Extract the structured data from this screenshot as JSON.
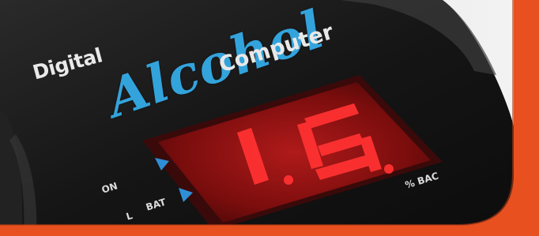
{
  "device": {
    "brand_line_1": "Digital",
    "brand_line_2": "Alcohol",
    "brand_line_3": "Computer",
    "display_reading": "1.6.",
    "indicator_on": "ON",
    "indicator_bat": "BAT",
    "indicator_l": "L",
    "unit_label": "% BAC"
  },
  "colors": {
    "frame_orange": "#e8501f",
    "device_body": "#1a1a1a",
    "display_red": "#ff2a2a",
    "alcohol_blue": "#33a3dc",
    "triangle_blue": "#2f8fd6"
  }
}
